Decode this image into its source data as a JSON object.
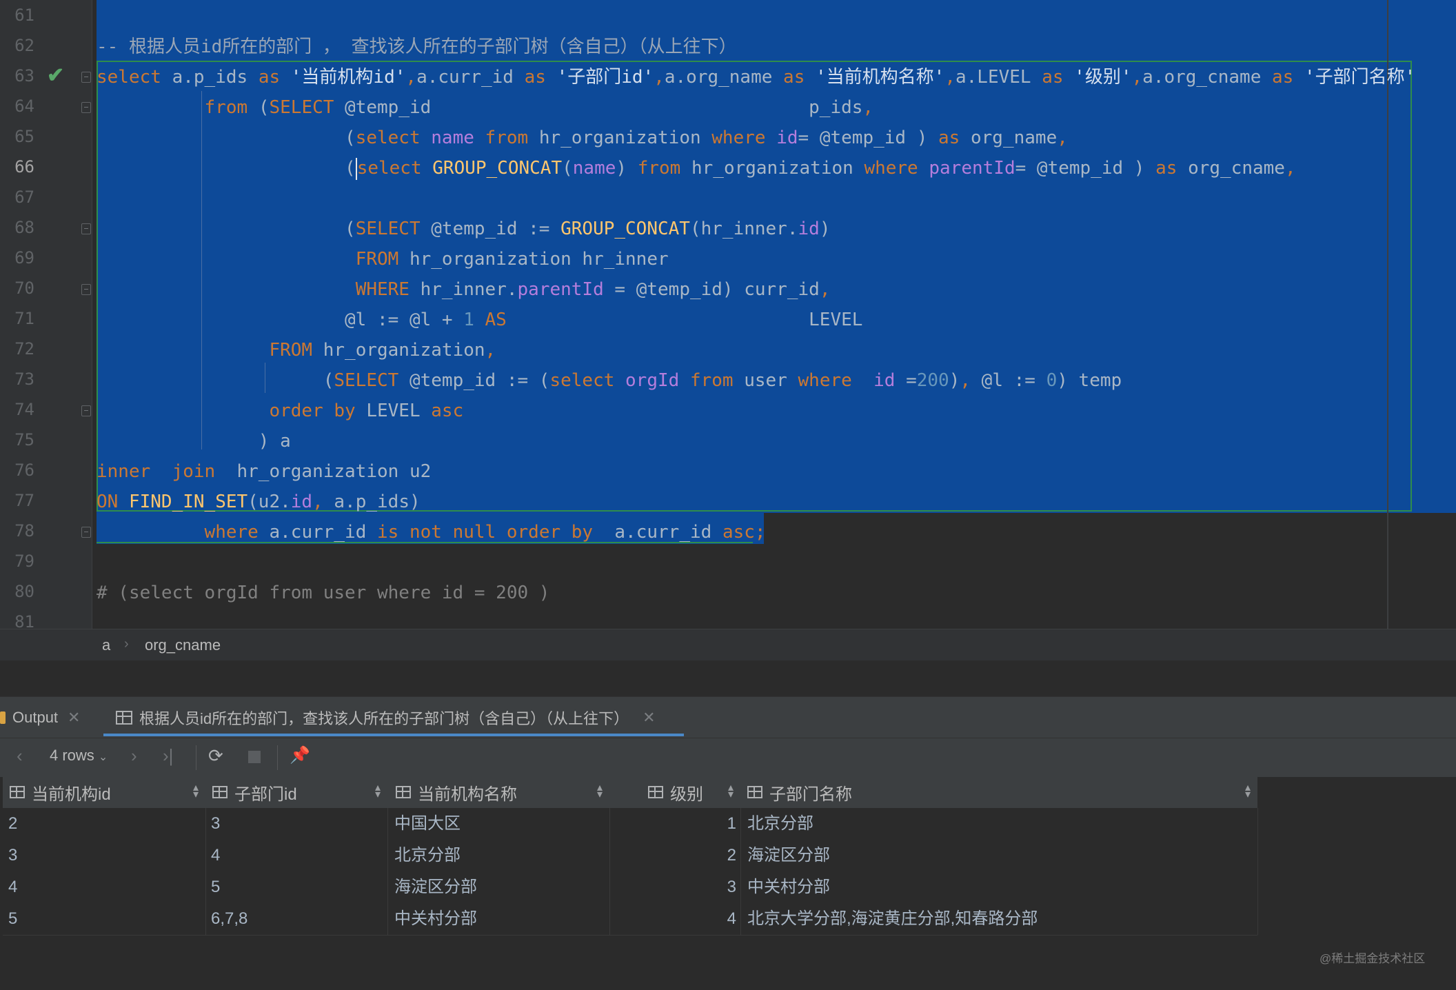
{
  "editor": {
    "line_numbers": [
      "61",
      "62",
      "63",
      "64",
      "65",
      "66",
      "67",
      "68",
      "69",
      "70",
      "71",
      "72",
      "73",
      "74",
      "75",
      "76",
      "77",
      "78",
      "79",
      "80",
      "81"
    ],
    "current_line": "66",
    "lines": [
      [],
      [
        {
          "t": "-- 根据人员id所在的部门 ， 查找该人所在的子部门树（含自己）（从上往下）",
          "c": "cm"
        }
      ],
      [
        {
          "t": "select",
          "c": "kw"
        },
        {
          "t": " a.p_ids ",
          "c": ""
        },
        {
          "t": "as",
          "c": "kw"
        },
        {
          "t": " '当前机构id'",
          "c": "str"
        },
        {
          "t": ",",
          "c": "kw"
        },
        {
          "t": "a.curr_id ",
          "c": ""
        },
        {
          "t": "as",
          "c": "kw"
        },
        {
          "t": " '子部门id'",
          "c": "str"
        },
        {
          "t": ",",
          "c": "kw"
        },
        {
          "t": "a.org_name ",
          "c": ""
        },
        {
          "t": "as",
          "c": "kw"
        },
        {
          "t": " '当前机构名称'",
          "c": "str"
        },
        {
          "t": ",",
          "c": "kw"
        },
        {
          "t": "a.LEVEL ",
          "c": ""
        },
        {
          "t": "as",
          "c": "kw"
        },
        {
          "t": " '级别'",
          "c": "str"
        },
        {
          "t": ",",
          "c": "kw"
        },
        {
          "t": "a.org_cname ",
          "c": ""
        },
        {
          "t": "as",
          "c": "kw"
        },
        {
          "t": " '子部门名称'",
          "c": "str"
        }
      ],
      [
        {
          "t": "          ",
          "c": ""
        },
        {
          "t": "from",
          "c": "kw"
        },
        {
          "t": " (",
          "c": ""
        },
        {
          "t": "SELECT",
          "c": "kw"
        },
        {
          "t": " @temp_id                                   p_ids",
          "c": ""
        },
        {
          "t": ",",
          "c": "kw"
        }
      ],
      [
        {
          "t": "                       (",
          "c": ""
        },
        {
          "t": "select",
          "c": "kw"
        },
        {
          "t": " ",
          "c": ""
        },
        {
          "t": "name",
          "c": "fld"
        },
        {
          "t": " ",
          "c": ""
        },
        {
          "t": "from",
          "c": "kw"
        },
        {
          "t": " hr_organization ",
          "c": ""
        },
        {
          "t": "where",
          "c": "kw"
        },
        {
          "t": " ",
          "c": ""
        },
        {
          "t": "id",
          "c": "fld"
        },
        {
          "t": "= @temp_id ) ",
          "c": ""
        },
        {
          "t": "as",
          "c": "kw"
        },
        {
          "t": " org_name",
          "c": ""
        },
        {
          "t": ",",
          "c": "kw"
        }
      ],
      [
        {
          "t": "                       (",
          "c": ""
        },
        {
          "t": "|",
          "c": "caret"
        },
        {
          "t": "select",
          "c": "kw"
        },
        {
          "t": " ",
          "c": ""
        },
        {
          "t": "GROUP_CONCAT",
          "c": "fn"
        },
        {
          "t": "(",
          "c": ""
        },
        {
          "t": "name",
          "c": "fld"
        },
        {
          "t": ") ",
          "c": ""
        },
        {
          "t": "from",
          "c": "kw"
        },
        {
          "t": " hr_organization ",
          "c": ""
        },
        {
          "t": "where",
          "c": "kw"
        },
        {
          "t": " ",
          "c": ""
        },
        {
          "t": "parentId",
          "c": "fld"
        },
        {
          "t": "= @temp_id ) ",
          "c": ""
        },
        {
          "t": "as",
          "c": "kw"
        },
        {
          "t": " org_cname",
          "c": ""
        },
        {
          "t": ",",
          "c": "kw"
        }
      ],
      [],
      [
        {
          "t": "                       (",
          "c": ""
        },
        {
          "t": "SELECT",
          "c": "kw"
        },
        {
          "t": " @temp_id := ",
          "c": ""
        },
        {
          "t": "GROUP_CONCAT",
          "c": "fn"
        },
        {
          "t": "(hr_inner.",
          "c": ""
        },
        {
          "t": "id",
          "c": "fld"
        },
        {
          "t": ")",
          "c": ""
        }
      ],
      [
        {
          "t": "                        ",
          "c": ""
        },
        {
          "t": "FROM",
          "c": "kw"
        },
        {
          "t": " hr_organization hr_inner",
          "c": ""
        }
      ],
      [
        {
          "t": "                        ",
          "c": ""
        },
        {
          "t": "WHERE",
          "c": "kw"
        },
        {
          "t": " hr_inner.",
          "c": ""
        },
        {
          "t": "parentId",
          "c": "fld"
        },
        {
          "t": " = @temp_id) curr_id",
          "c": ""
        },
        {
          "t": ",",
          "c": "kw"
        }
      ],
      [
        {
          "t": "                       @l := @l + ",
          "c": ""
        },
        {
          "t": "1",
          "c": "num"
        },
        {
          "t": " ",
          "c": ""
        },
        {
          "t": "AS",
          "c": "kw"
        },
        {
          "t": "                            LEVEL",
          "c": ""
        }
      ],
      [
        {
          "t": "                ",
          "c": ""
        },
        {
          "t": "FROM",
          "c": "kw"
        },
        {
          "t": " hr_organization",
          "c": ""
        },
        {
          "t": ",",
          "c": "kw"
        }
      ],
      [
        {
          "t": "                     (",
          "c": ""
        },
        {
          "t": "SELECT",
          "c": "kw"
        },
        {
          "t": " @temp_id := (",
          "c": ""
        },
        {
          "t": "select",
          "c": "kw"
        },
        {
          "t": " ",
          "c": ""
        },
        {
          "t": "orgId",
          "c": "fld"
        },
        {
          "t": " ",
          "c": ""
        },
        {
          "t": "from",
          "c": "kw"
        },
        {
          "t": " user ",
          "c": ""
        },
        {
          "t": "where",
          "c": "kw"
        },
        {
          "t": "  ",
          "c": ""
        },
        {
          "t": "id",
          "c": "fld"
        },
        {
          "t": " =",
          "c": ""
        },
        {
          "t": "200",
          "c": "num"
        },
        {
          "t": ")",
          "c": ""
        },
        {
          "t": ",",
          "c": "kw"
        },
        {
          "t": " @l := ",
          "c": ""
        },
        {
          "t": "0",
          "c": "num"
        },
        {
          "t": ") temp",
          "c": ""
        }
      ],
      [
        {
          "t": "                ",
          "c": ""
        },
        {
          "t": "order by",
          "c": "kw"
        },
        {
          "t": " LEVEL ",
          "c": ""
        },
        {
          "t": "asc",
          "c": "kw"
        }
      ],
      [
        {
          "t": "               ) a",
          "c": ""
        }
      ],
      [
        {
          "t": "inner  join",
          "c": "kw"
        },
        {
          "t": "  hr_organization u2",
          "c": ""
        }
      ],
      [
        {
          "t": "ON",
          "c": "kw"
        },
        {
          "t": " ",
          "c": ""
        },
        {
          "t": "FIND_IN_SET",
          "c": "fn"
        },
        {
          "t": "(u2.",
          "c": ""
        },
        {
          "t": "id",
          "c": "fld"
        },
        {
          "t": ",",
          "c": "kw"
        },
        {
          "t": " a.p_ids)",
          "c": ""
        }
      ],
      [
        {
          "t": "          ",
          "c": ""
        },
        {
          "t": "where",
          "c": "kw"
        },
        {
          "t": " a.curr_id ",
          "c": ""
        },
        {
          "t": "is not null order by",
          "c": "kw"
        },
        {
          "t": "  a.curr_id ",
          "c": ""
        },
        {
          "t": "asc;",
          "c": "kw"
        }
      ],
      [],
      [
        {
          "t": "# (select orgId from user where id = 200 )",
          "c": "cm2"
        }
      ],
      []
    ]
  },
  "breadcrumb": {
    "first": "a",
    "separator": "›",
    "second": "org_cname"
  },
  "tool_tabs": {
    "output_label": "Output",
    "result_label": "根据人员id所在的部门，查找该人所在的子部门树（含自己）（从上往下）",
    "close_glyph": "✕"
  },
  "result_toolbar": {
    "rows_label": "4 rows"
  },
  "grid": {
    "columns": [
      "当前机构id",
      "子部门id",
      "当前机构名称",
      "级别",
      "子部门名称"
    ],
    "rows": [
      [
        "2",
        "3",
        "中国大区",
        "1",
        "北京分部"
      ],
      [
        "3",
        "4",
        "北京分部",
        "2",
        "海淀区分部"
      ],
      [
        "4",
        "5",
        "海淀区分部",
        "3",
        "中关村分部"
      ],
      [
        "5",
        "6,7,8",
        "中关村分部",
        "4",
        "北京大学分部,海淀黄庄分部,知春路分部"
      ]
    ]
  },
  "watermark": "@稀土掘金技术社区",
  "colors": {
    "selection": "#0d4a99",
    "keyword": "#cc7832",
    "function": "#ffc66d",
    "field": "#b57edc",
    "number": "#6897bb"
  }
}
